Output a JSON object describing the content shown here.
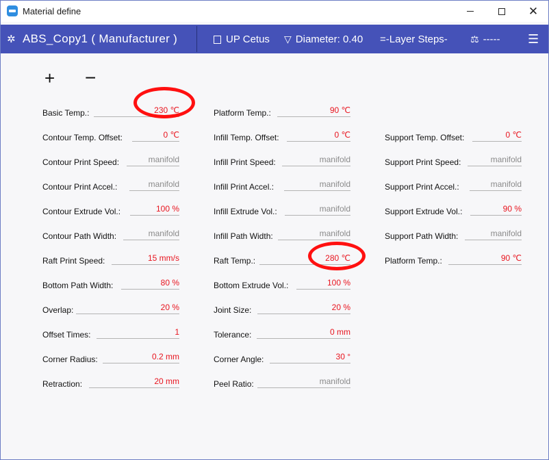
{
  "window": {
    "title": "Material define"
  },
  "header": {
    "material": "ABS_Copy1 ( Manufacturer )",
    "printer": "UP Cetus",
    "diameter": "Diameter: 0.40",
    "layers": "=-Layer Steps-",
    "scale_value": "-----"
  },
  "toolbar": {
    "add": "+",
    "remove": "−"
  },
  "fields": {
    "basic_temp": {
      "label": "Basic Temp.:",
      "value": "230 ℃"
    },
    "platform_temp": {
      "label": "Platform Temp.:",
      "value": "90 ℃"
    },
    "contour_temp_offset": {
      "label": "Contour Temp. Offset:",
      "value": "0 ℃"
    },
    "infill_temp_offset": {
      "label": "Infill Temp. Offset:",
      "value": "0 ℃"
    },
    "support_temp_offset": {
      "label": "Support Temp. Offset:",
      "value": "0 ℃"
    },
    "contour_print_speed": {
      "label": "Contour Print Speed:",
      "value": "manifold"
    },
    "infill_print_speed": {
      "label": "Infill Print Speed:",
      "value": "manifold"
    },
    "support_print_speed": {
      "label": "Support Print Speed:",
      "value": "manifold"
    },
    "contour_print_accel": {
      "label": "Contour Print Accel.:",
      "value": "manifold"
    },
    "infill_print_accel": {
      "label": "Infill Print Accel.:",
      "value": "manifold"
    },
    "support_print_accel": {
      "label": "Support Print Accel.:",
      "value": "manifold"
    },
    "contour_extrude_vol": {
      "label": "Contour Extrude Vol.:",
      "value": "100 %"
    },
    "infill_extrude_vol": {
      "label": "Infill Extrude Vol.:",
      "value": "manifold"
    },
    "support_extrude_vol": {
      "label": "Support Extrude Vol.:",
      "value": "90 %"
    },
    "contour_path_width": {
      "label": "Contour Path Width:",
      "value": "manifold"
    },
    "infill_path_width": {
      "label": "Infill Path Width:",
      "value": "manifold"
    },
    "support_path_width": {
      "label": "Support Path Width:",
      "value": "manifold"
    },
    "raft_print_speed": {
      "label": "Raft Print Speed:",
      "value": "15 mm/s"
    },
    "raft_temp": {
      "label": "Raft Temp.:",
      "value": "280 ℃"
    },
    "support_platform_temp": {
      "label": "Platform Temp.:",
      "value": "90 ℃"
    },
    "bottom_path_width": {
      "label": "Bottom Path Width:",
      "value": "80 %"
    },
    "bottom_extrude_vol": {
      "label": "Bottom Extrude Vol.:",
      "value": "100 %"
    },
    "overlap": {
      "label": "Overlap:",
      "value": "20 %"
    },
    "joint_size": {
      "label": "Joint Size:",
      "value": "20 %"
    },
    "offset_times": {
      "label": "Offset Times:",
      "value": "1"
    },
    "tolerance": {
      "label": "Tolerance:",
      "value": "0 mm"
    },
    "corner_radius": {
      "label": "Corner Radius:",
      "value": "0.2 mm"
    },
    "corner_angle": {
      "label": "Corner Angle:",
      "value": "30 °"
    },
    "retraction": {
      "label": "Retraction:",
      "value": "20 mm"
    },
    "peel_ratio": {
      "label": "Peel Ratio:",
      "value": "manifold"
    }
  },
  "colors": {
    "header_bg": "#4552b8",
    "value_red": "#e8141e",
    "value_gray": "#8a8a8a",
    "annotation_red": "#ff1010"
  }
}
